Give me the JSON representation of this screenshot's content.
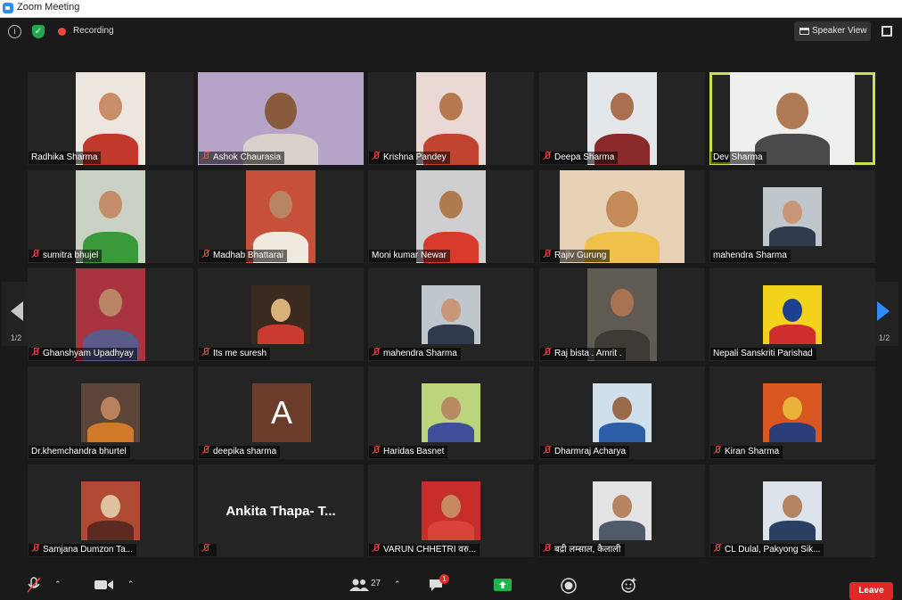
{
  "window": {
    "title": "Zoom Meeting"
  },
  "topbar": {
    "recording_label": "Recording",
    "view_label": "Speaker View"
  },
  "pager": {
    "left_label": "1/2",
    "right_label": "1/2"
  },
  "participants": [
    {
      "name": "Radhika Sharma",
      "muted": false,
      "bg": "#ece6de",
      "skin": "#c98d6a",
      "cloth": "#c0392b"
    },
    {
      "name": "Ashok Chaurasia",
      "muted": true,
      "bg": "#b6a4c8",
      "skin": "#8a5a3c",
      "cloth": "#d9d2cc"
    },
    {
      "name": "Krishna Pandey",
      "muted": true,
      "bg": "#e9d8d4",
      "skin": "#b6784f",
      "cloth": "#c0442f"
    },
    {
      "name": "Deepa Sharma",
      "muted": true,
      "bg": "#e4e7ea",
      "skin": "#a8704e",
      "cloth": "#8b2a2a"
    },
    {
      "name": "Dev Sharma",
      "muted": false,
      "bg": "#eef0ee",
      "skin": "#b07a55",
      "cloth": "#4a4a4a"
    },
    {
      "name": "sumitra bhujel",
      "muted": true,
      "bg": "#c9d2c4",
      "skin": "#c48d6a",
      "cloth": "#3a9a3a"
    },
    {
      "name": "Madhab Bhattarai",
      "muted": true,
      "bg": "#c7503a",
      "skin": "#b98463",
      "cloth": "#efe9de"
    },
    {
      "name": "Moni kumar Newar",
      "muted": false,
      "bg": "#cfcfd2",
      "skin": "#b07a4f",
      "cloth": "#d83a2b"
    },
    {
      "name": "Rajiv Gurung",
      "muted": true,
      "bg": "#e7d2b6",
      "skin": "#c48a5a",
      "cloth": "#f0c14a"
    },
    {
      "name": "mahendra Sharma",
      "muted": false,
      "bg": "#bfc6cc",
      "skin": "#c79777",
      "cloth": "#2f3b4d"
    },
    {
      "name": "Ghanshyam Upadhyay",
      "muted": true,
      "bg": "#a7343f",
      "skin": "#b98464",
      "cloth": "#5b5b8a"
    },
    {
      "name": "Its me suresh",
      "muted": true,
      "bg": "#3b2a20",
      "skin": "#d9b27a",
      "cloth": "#c93a2f"
    },
    {
      "name": "mahendra Sharma",
      "muted": true,
      "bg": "#bfc6cc",
      "skin": "#c79777",
      "cloth": "#2f3b4d"
    },
    {
      "name": "Raj bista . Amrit .",
      "muted": true,
      "bg": "#5f5a52",
      "skin": "#a77350",
      "cloth": "#3e3a35"
    },
    {
      "name": "Nepali Sanskriti Parishad",
      "muted": false,
      "bg": "#f2d21a",
      "skin": "#1f3f8f",
      "cloth": "#d02e2e"
    },
    {
      "name": "Dr.khemchandra bhurtel",
      "muted": false,
      "bg": "#5b4538",
      "skin": "#b9825c",
      "cloth": "#d07a2a"
    },
    {
      "name": "deepika sharma",
      "muted": true,
      "avatar_letter": "A"
    },
    {
      "name": "Haridas Basnet",
      "muted": true,
      "bg": "#bcd47b",
      "skin": "#b78a62",
      "cloth": "#3f4f9a"
    },
    {
      "name": "Dharmraj Acharya",
      "muted": true,
      "bg": "#cfe0ec",
      "skin": "#9a6a4a",
      "cloth": "#2d5fa8"
    },
    {
      "name": "Kiran Sharma",
      "muted": true,
      "bg": "#d8561f",
      "skin": "#e9b23a",
      "cloth": "#2c3e7a"
    },
    {
      "name": "Samjana Dumzon Ta...",
      "muted": true,
      "bg": "#b04a35",
      "skin": "#e0c2a0",
      "cloth": "#5c2a20"
    },
    {
      "name": "",
      "muted": true,
      "big_name": "Ankita Thapa- T..."
    },
    {
      "name": "VARUN CHHETRI वरु...",
      "muted": true,
      "bg": "#c72e2a",
      "skin": "#c78a5e",
      "cloth": "#d8443a"
    },
    {
      "name": "बद्री लम्साल, कैलाली",
      "muted": true,
      "bg": "#e4e4e4",
      "skin": "#b98262",
      "cloth": "#505a6a"
    },
    {
      "name": "CL Dulal, Pakyong Sik...",
      "muted": true,
      "bg": "#dde3ea",
      "skin": "#b48461",
      "cloth": "#2b3f64"
    }
  ],
  "bottombar": {
    "participants_count": "27",
    "chat_badge": "1",
    "leave_label": "Leave"
  }
}
